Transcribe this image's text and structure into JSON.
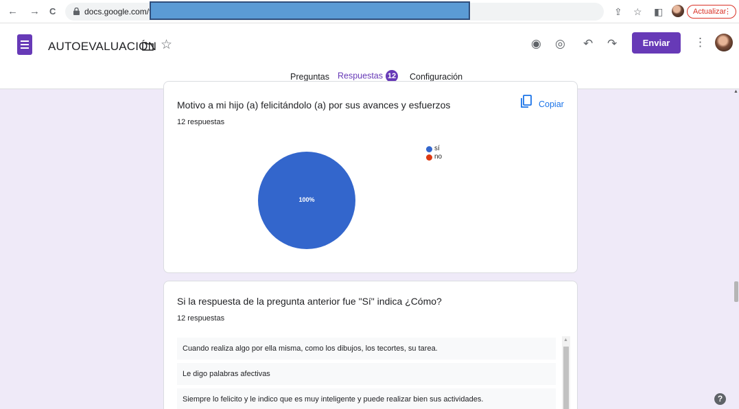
{
  "browser": {
    "back_icon": "←",
    "forward_icon": "→",
    "reload_icon": "C",
    "url": "docs.google.com/fo",
    "share_icon": "⇪",
    "bookmark_icon": "☆",
    "sidepanel_icon": "◧",
    "update_label": "Actualizar",
    "update_menu": "⋮"
  },
  "header": {
    "title": "AUTOEVALUACIÓN",
    "star_icon": "☆",
    "palette_icon": "◉",
    "preview_icon": "◎",
    "undo_icon": "↶",
    "redo_icon": "↷",
    "send_label": "Enviar",
    "more_icon": "⋮"
  },
  "tabs": {
    "questions": "Preguntas",
    "responses": "Respuestas",
    "responses_count": "12",
    "settings": "Configuración"
  },
  "question1": {
    "title": "Motivo a mi hijo (a) felicitándolo (a) por sus avances y esfuerzos",
    "count": "12 respuestas",
    "copy_label": "Copiar"
  },
  "chart_data": {
    "type": "pie",
    "categories": [
      "sí",
      "no"
    ],
    "values": [
      100,
      0
    ],
    "slice_label": "100%",
    "colors": [
      "#3366cc",
      "#dc3912"
    ],
    "legend_position": "right"
  },
  "question2": {
    "title": "Si la respuesta de la pregunta anterior fue \"Sí\" indica ¿Cómo?",
    "count": "12 respuestas",
    "answers": [
      "Cuando realiza algo por ella misma, como los dibujos, los tecortes, su tarea.",
      "Le digo palabras afectivas",
      "Siempre lo felicito y le indico que es muy inteligente y puede realizar bien sus actividades."
    ]
  },
  "help_label": "?",
  "colors": {
    "brand": "#673ab7",
    "background": "#efeaf8",
    "link": "#1a73e8",
    "update": "#d93025"
  }
}
